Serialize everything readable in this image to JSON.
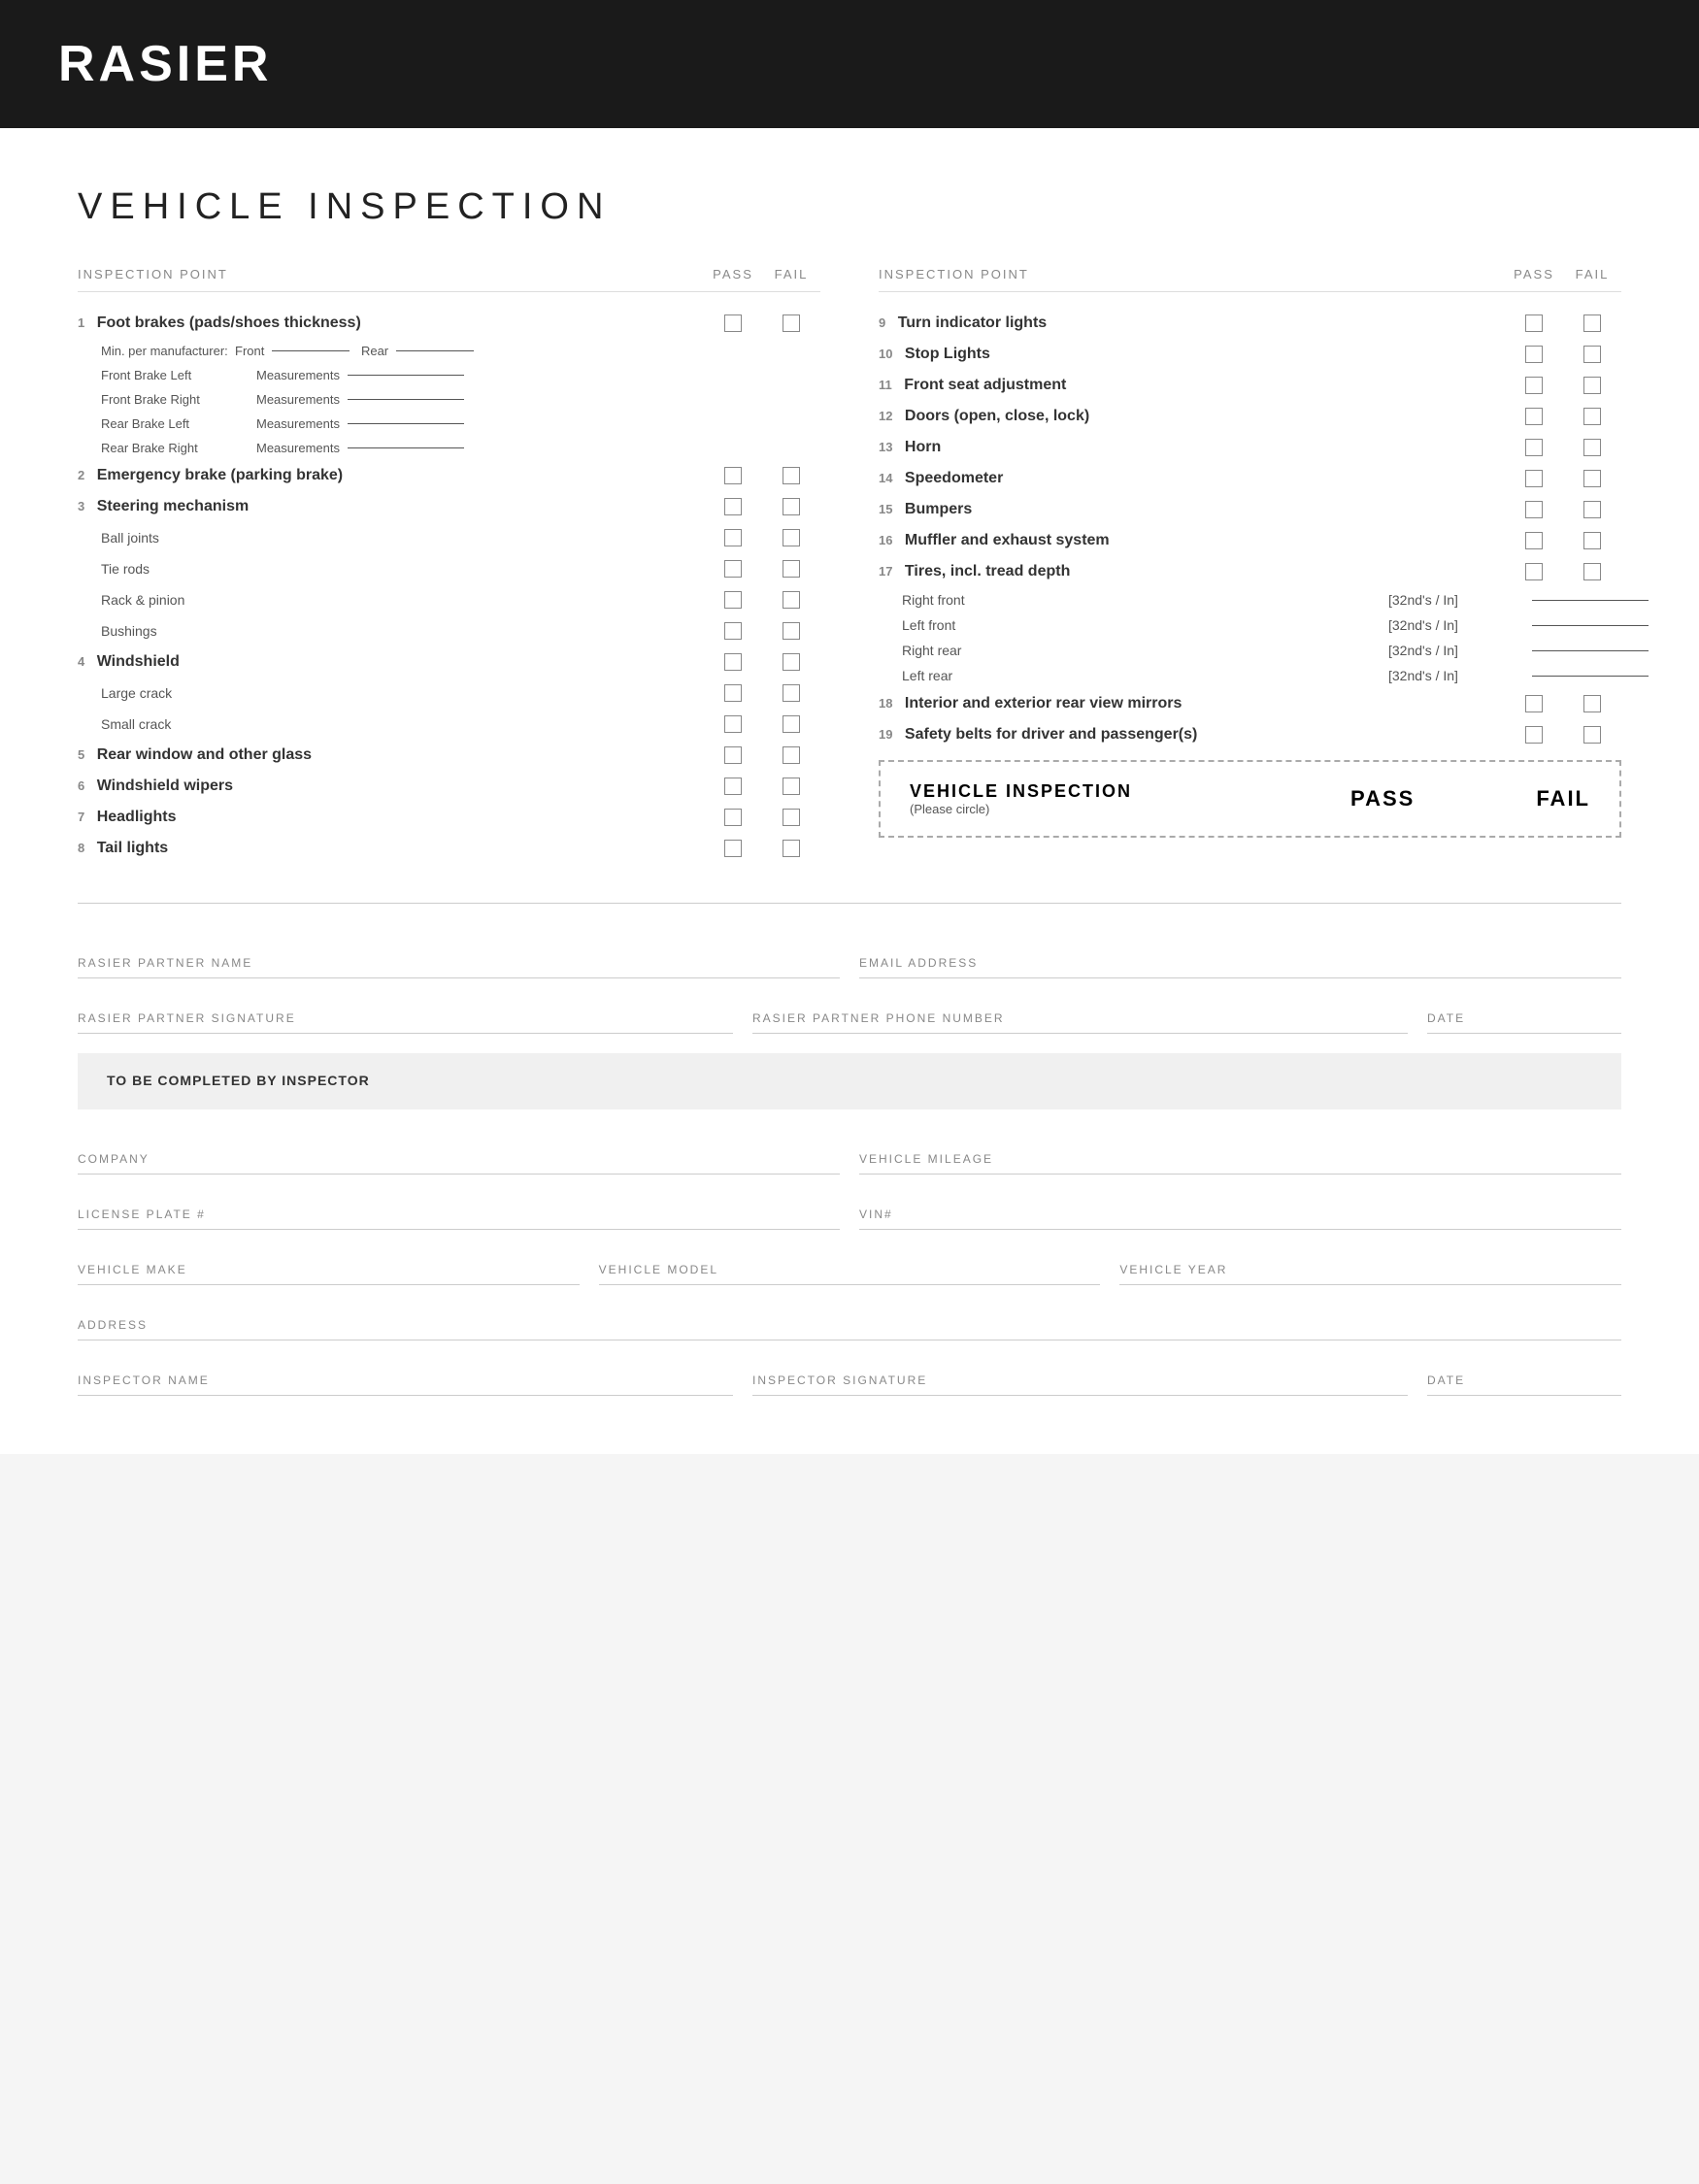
{
  "header": {
    "title": "RASIER"
  },
  "page": {
    "title": "VEHICLE INSPECTION"
  },
  "columns": {
    "inspection_point": "INSPECTION POINT",
    "pass": "PASS",
    "fail": "FAIL"
  },
  "left_items": [
    {
      "number": "1",
      "label": "Foot brakes (pads/shoes thickness)",
      "main": true,
      "has_checkbox": true,
      "sub_items": [],
      "has_measurements": true,
      "measurement_lines": [
        {
          "label": "Min. per manufacturer:  Front",
          "extra": "Rear"
        },
        {
          "label": "Front Brake Left",
          "meas": "Measurements"
        },
        {
          "label": "Front Brake Right",
          "meas": "Measurements"
        },
        {
          "label": "Rear Brake Left",
          "meas": "Measurements"
        },
        {
          "label": "Rear Brake Right",
          "meas": "Measurements"
        }
      ]
    },
    {
      "number": "2",
      "label": "Emergency brake (parking brake)",
      "main": true,
      "has_checkbox": true
    },
    {
      "number": "3",
      "label": "Steering mechanism",
      "main": true,
      "has_checkbox": true,
      "sub_items": [
        {
          "label": "Ball joints",
          "has_checkbox": true
        },
        {
          "label": "Tie rods",
          "has_checkbox": true
        },
        {
          "label": "Rack & pinion",
          "has_checkbox": true
        },
        {
          "label": "Bushings",
          "has_checkbox": true
        }
      ]
    },
    {
      "number": "4",
      "label": "Windshield",
      "main": true,
      "has_checkbox": true,
      "sub_items": [
        {
          "label": "Large crack",
          "has_checkbox": true
        },
        {
          "label": "Small crack",
          "has_checkbox": true
        }
      ]
    },
    {
      "number": "5",
      "label": "Rear window and other glass",
      "main": true,
      "has_checkbox": true
    },
    {
      "number": "6",
      "label": "Windshield wipers",
      "main": true,
      "has_checkbox": true
    },
    {
      "number": "7",
      "label": "Headlights",
      "main": true,
      "has_checkbox": true
    },
    {
      "number": "8",
      "label": "Tail lights",
      "main": true,
      "has_checkbox": true
    }
  ],
  "right_items": [
    {
      "number": "9",
      "label": "Turn indicator lights",
      "main": true,
      "has_checkbox": true
    },
    {
      "number": "10",
      "label": "Stop Lights",
      "main": true,
      "has_checkbox": true
    },
    {
      "number": "11",
      "label": "Front seat adjustment",
      "main": true,
      "has_checkbox": true
    },
    {
      "number": "12",
      "label": "Doors (open, close, lock)",
      "main": true,
      "has_checkbox": true
    },
    {
      "number": "13",
      "label": "Horn",
      "main": true,
      "has_checkbox": true
    },
    {
      "number": "14",
      "label": "Speedometer",
      "main": true,
      "has_checkbox": true
    },
    {
      "number": "15",
      "label": "Bumpers",
      "main": true,
      "has_checkbox": true
    },
    {
      "number": "16",
      "label": "Muffler and exhaust system",
      "main": true,
      "has_checkbox": true
    },
    {
      "number": "17",
      "label": "Tires, incl. tread depth",
      "main": true,
      "has_checkbox": true,
      "tread_items": [
        {
          "label": "Right front",
          "unit": "[32nd's / In]"
        },
        {
          "label": "Left front",
          "unit": "[32nd's / In]"
        },
        {
          "label": "Right rear",
          "unit": "[32nd's / In]"
        },
        {
          "label": "Left rear",
          "unit": "[32nd's / In]"
        }
      ]
    },
    {
      "number": "18",
      "label": "Interior and exterior rear view mirrors",
      "main": true,
      "has_checkbox": true
    },
    {
      "number": "19",
      "label": "Safety belts for driver and passenger(s)",
      "main": true,
      "has_checkbox": true
    }
  ],
  "pass_fail_box": {
    "title": "VEHICLE INSPECTION",
    "subtitle": "(Please circle)",
    "pass_label": "PASS",
    "fail_label": "FAIL"
  },
  "form_fields": {
    "partner_name_label": "RASIER PARTNER NAME",
    "email_label": "EMAIL ADDRESS",
    "signature_label": "RASIER PARTNER SIGNATURE",
    "phone_label": "RASIER PARTNER PHONE NUMBER",
    "date_label": "DATE",
    "to_be_completed_label": "TO BE COMPLETED BY INSPECTOR",
    "company_label": "COMPANY",
    "mileage_label": "VEHICLE MILEAGE",
    "license_label": "LICENSE PLATE #",
    "vin_label": "VIN#",
    "make_label": "VEHICLE MAKE",
    "model_label": "VEHICLE MODEL",
    "year_label": "VEHICLE YEAR",
    "address_label": "ADDRESS",
    "inspector_name_label": "INSPECTOR NAME",
    "inspector_signature_label": "INSPECTOR SIGNATURE",
    "inspector_date_label": "DATE"
  }
}
